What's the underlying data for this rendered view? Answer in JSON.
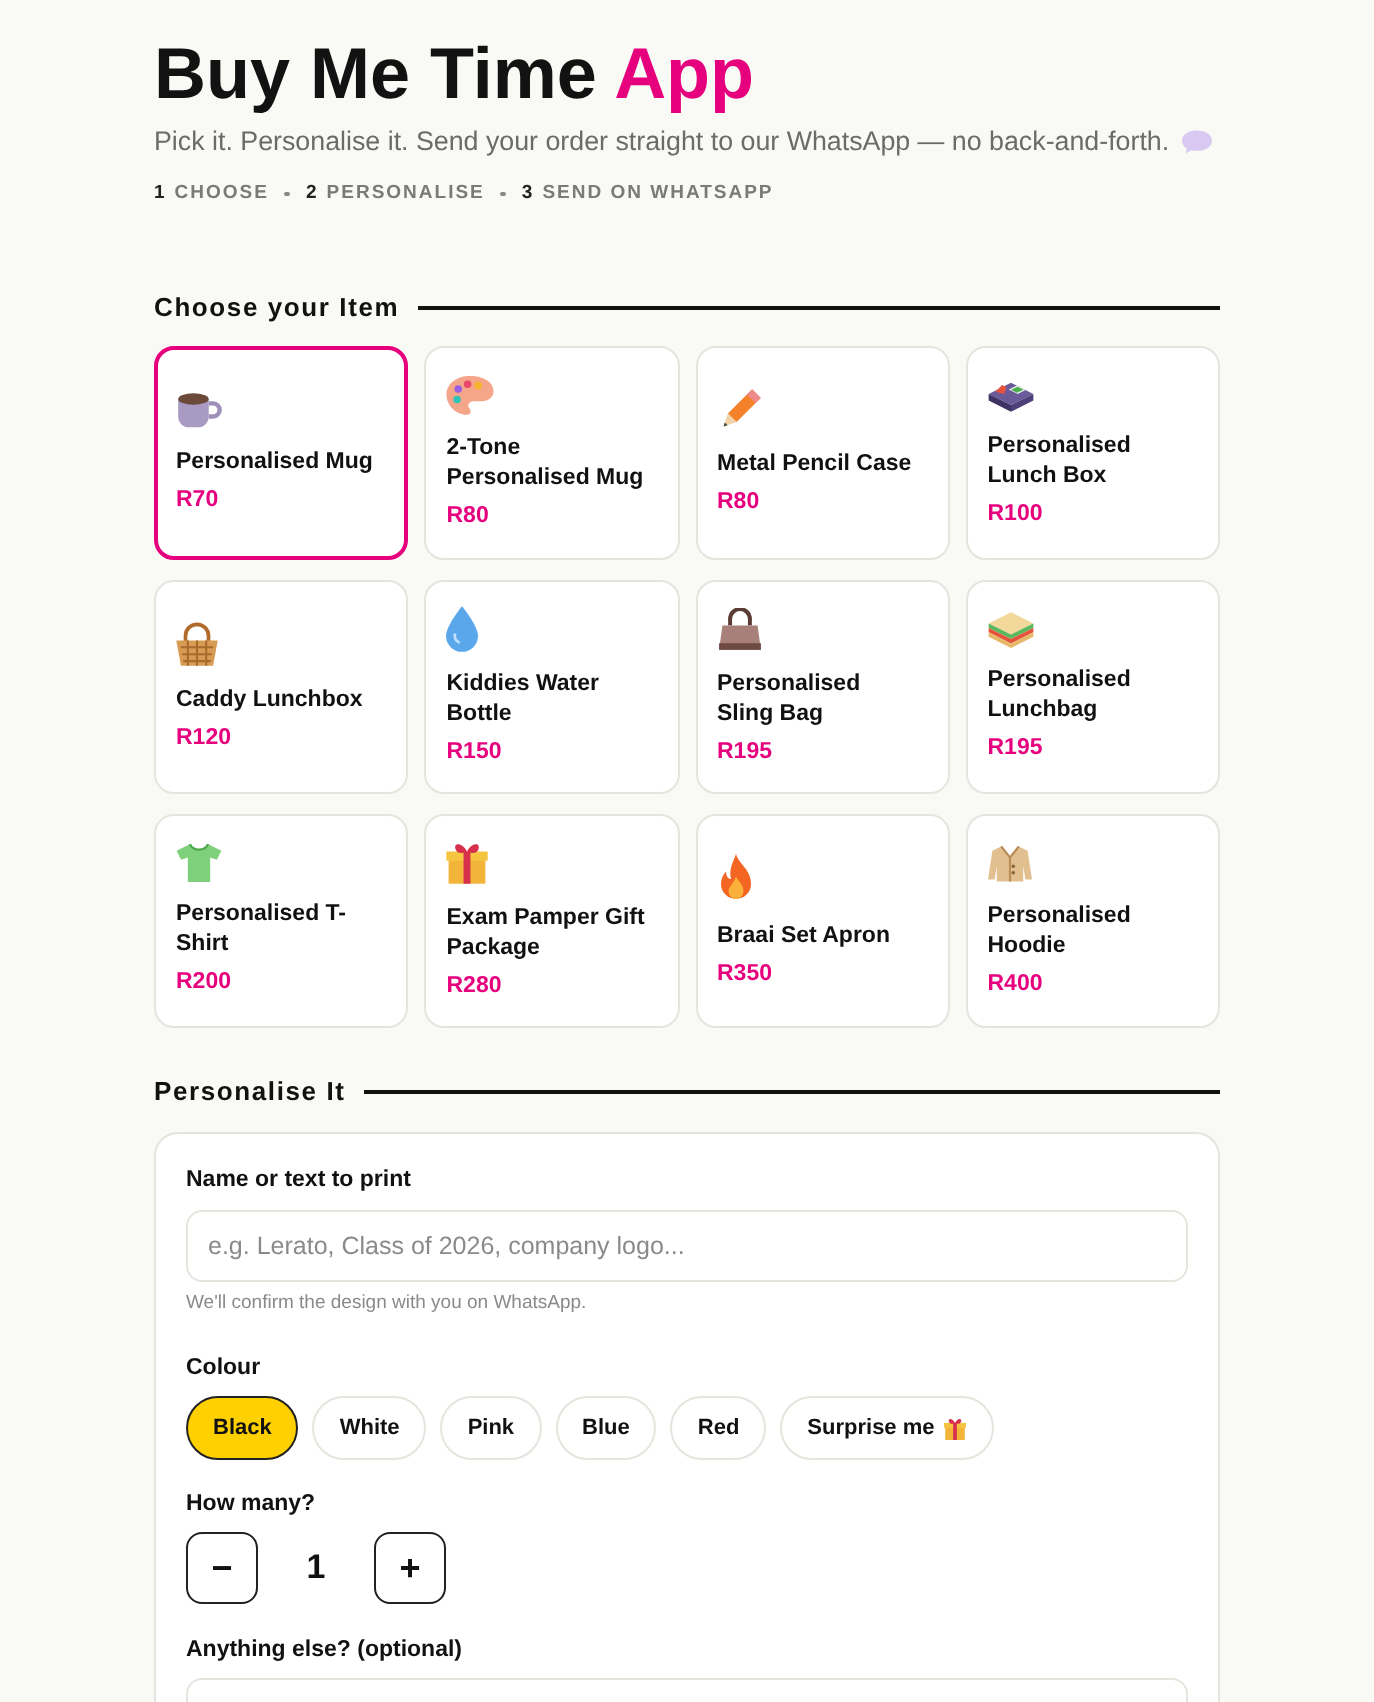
{
  "header": {
    "title": "Buy Me Time",
    "title_accent": "App",
    "subtitle": "Pick it. Personalise it. Send your order straight to our WhatsApp — no back-and-forth.",
    "steps": [
      {
        "number": "1",
        "label": "CHOOSE"
      },
      {
        "number": "2",
        "label": "PERSONALISE"
      },
      {
        "number": "3",
        "label": "SEND ON WHATSAPP"
      }
    ]
  },
  "choose": {
    "heading": "Choose your Item",
    "items": [
      {
        "name": "Personalised Mug",
        "price": "R70",
        "selected": true
      },
      {
        "name": "2-Tone Personalised Mug",
        "price": "R80",
        "selected": false
      },
      {
        "name": "Metal Pencil Case",
        "price": "R80",
        "selected": false
      },
      {
        "name": "Personalised Lunch Box",
        "price": "R100",
        "selected": false
      },
      {
        "name": "Caddy Lunchbox",
        "price": "R120",
        "selected": false
      },
      {
        "name": "Kiddies Water Bottle",
        "price": "R150",
        "selected": false
      },
      {
        "name": "Personalised Sling Bag",
        "price": "R195",
        "selected": false
      },
      {
        "name": "Personalised Lunchbag",
        "price": "R195",
        "selected": false
      },
      {
        "name": "Personalised T-Shirt",
        "price": "R200",
        "selected": false
      },
      {
        "name": "Exam Pamper Gift Package",
        "price": "R280",
        "selected": false
      },
      {
        "name": "Braai Set Apron",
        "price": "R350",
        "selected": false
      },
      {
        "name": "Personalised Hoodie",
        "price": "R400",
        "selected": false
      }
    ]
  },
  "personalise": {
    "heading": "Personalise It",
    "name_field": {
      "label": "Name or text to print",
      "placeholder": "e.g. Lerato, Class of 2026, company logo...",
      "hint": "We'll confirm the design with you on WhatsApp."
    },
    "colour": {
      "label": "Colour",
      "options": [
        {
          "label": "Black",
          "kind": "colour",
          "selected": true
        },
        {
          "label": "White",
          "kind": "colour",
          "selected": false
        },
        {
          "label": "Pink",
          "kind": "colour",
          "selected": false
        },
        {
          "label": "Blue",
          "kind": "colour",
          "selected": false
        },
        {
          "label": "Red",
          "kind": "colour",
          "selected": false
        },
        {
          "label": "Surprise me",
          "kind": "surprise",
          "selected": false
        }
      ]
    },
    "quantity": {
      "label": "How many?",
      "decrement": "−",
      "value": "1",
      "increment": "+"
    },
    "notes": {
      "label": "Anything else? (optional)"
    }
  }
}
